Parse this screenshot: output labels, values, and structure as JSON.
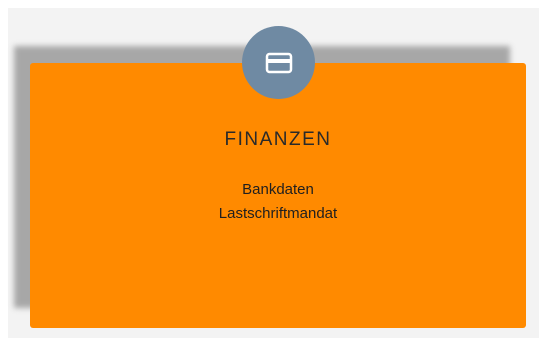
{
  "tile": {
    "title": "FINANZEN",
    "icon": "credit-card-icon",
    "links": [
      "Bankdaten",
      "Lastschriftmandat"
    ],
    "colors": {
      "card": "#ff8a00",
      "icon_circle": "#6f8aa3",
      "panel": "#f3f3f3"
    }
  }
}
